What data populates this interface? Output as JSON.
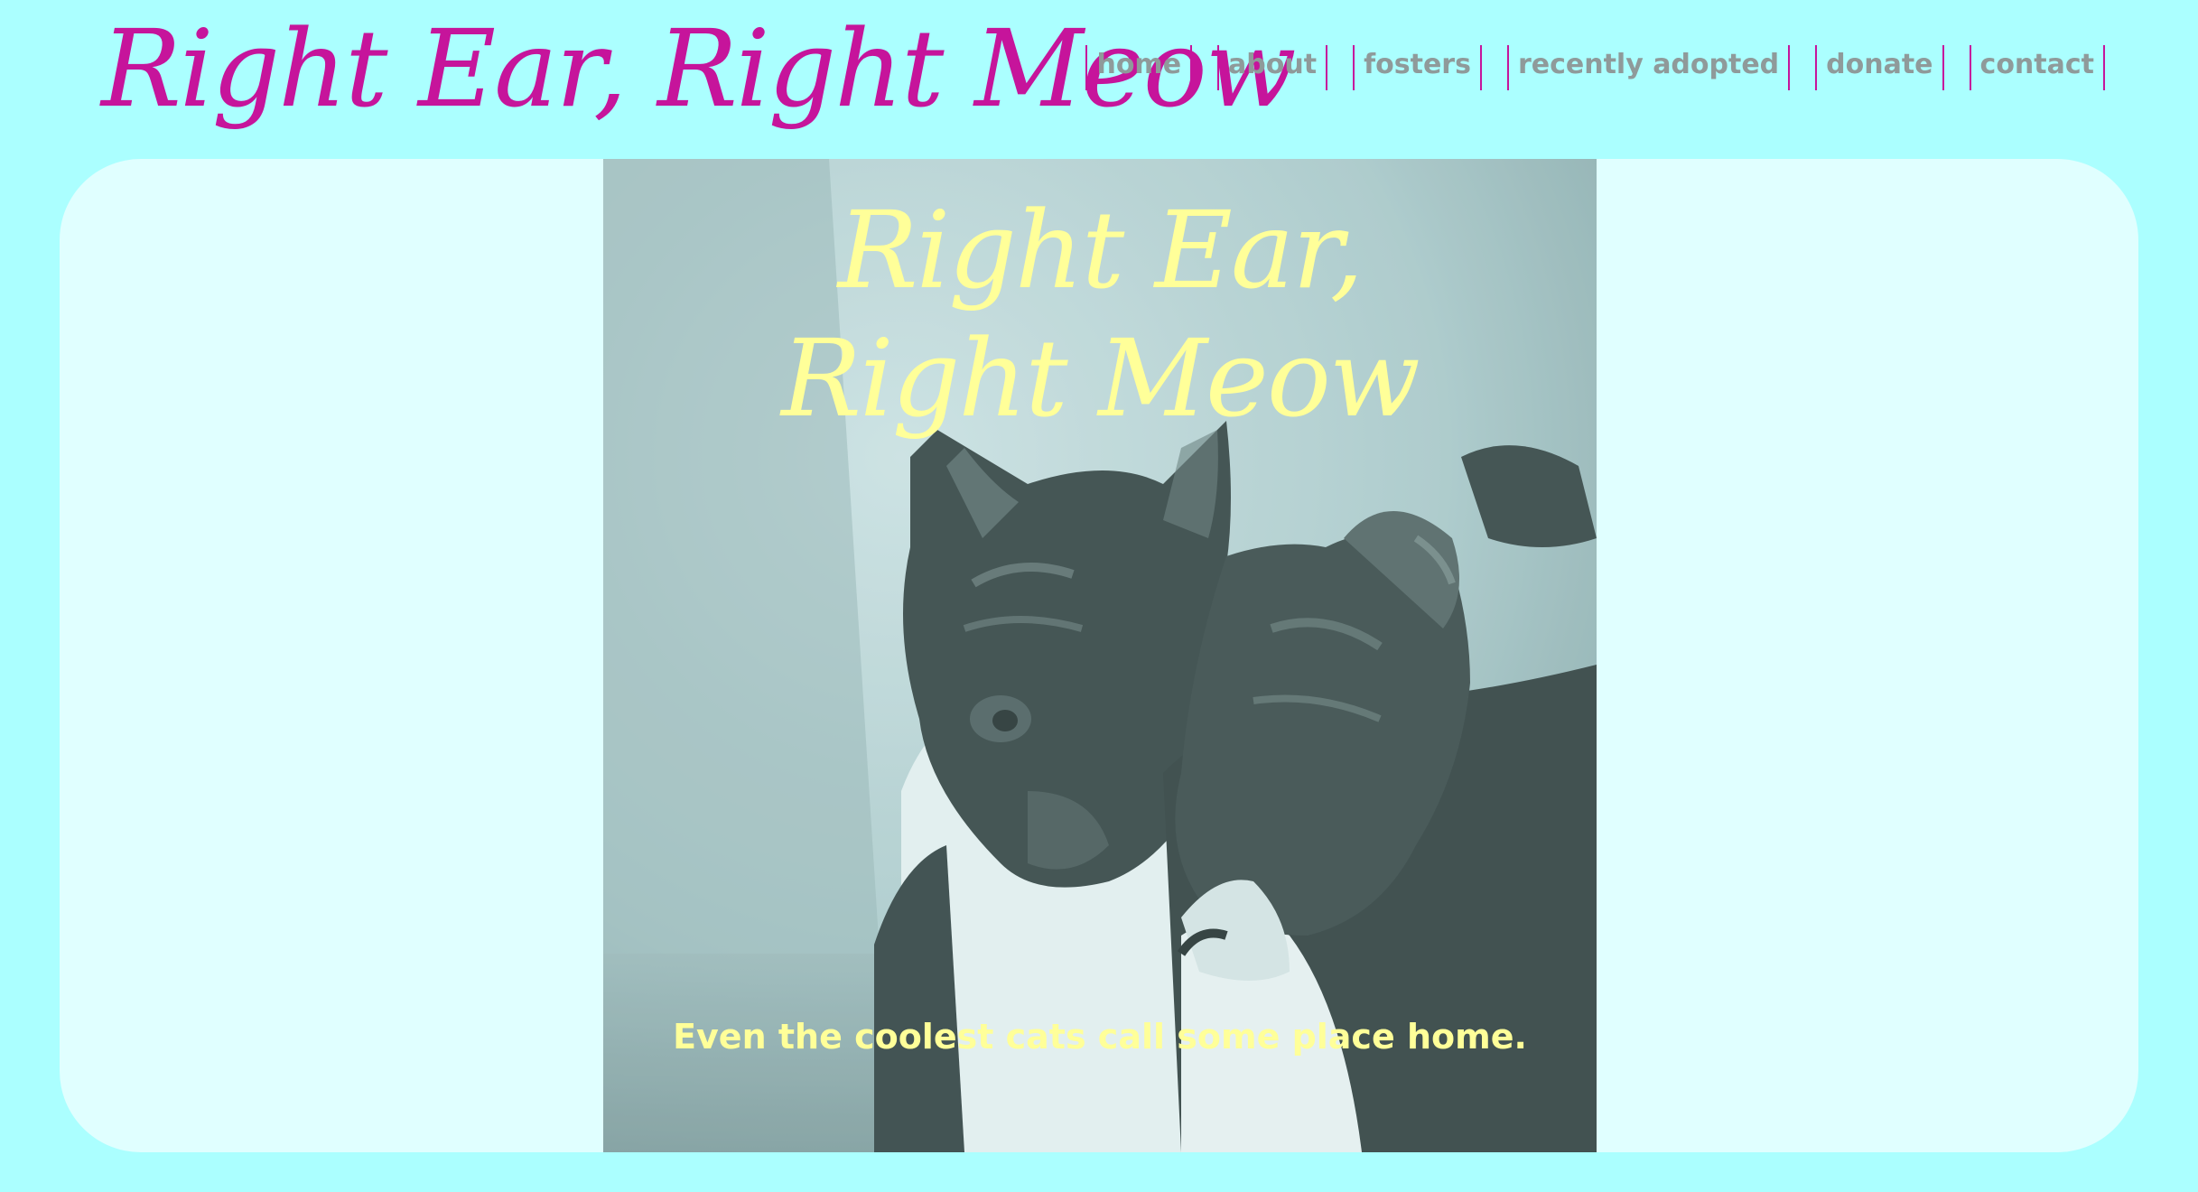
{
  "header": {
    "site_title": "Right Ear, Right Meow"
  },
  "nav": {
    "items": [
      {
        "label": "home"
      },
      {
        "label": "about"
      },
      {
        "label": "fosters"
      },
      {
        "label": "recently adopted"
      },
      {
        "label": "donate"
      },
      {
        "label": "contact"
      }
    ]
  },
  "hero": {
    "title_line1": "Right Ear,",
    "title_line2": "Right Meow",
    "tagline": "Even the coolest cats call some place home."
  },
  "colors": {
    "background": "#abffff",
    "panel": "#e0ffff",
    "accent_magenta": "#c6149b",
    "nav_text": "#8f9a9a",
    "hero_text_yellow": "#ffff99"
  },
  "icons": {
    "hero_image": "two-cats-photo"
  }
}
